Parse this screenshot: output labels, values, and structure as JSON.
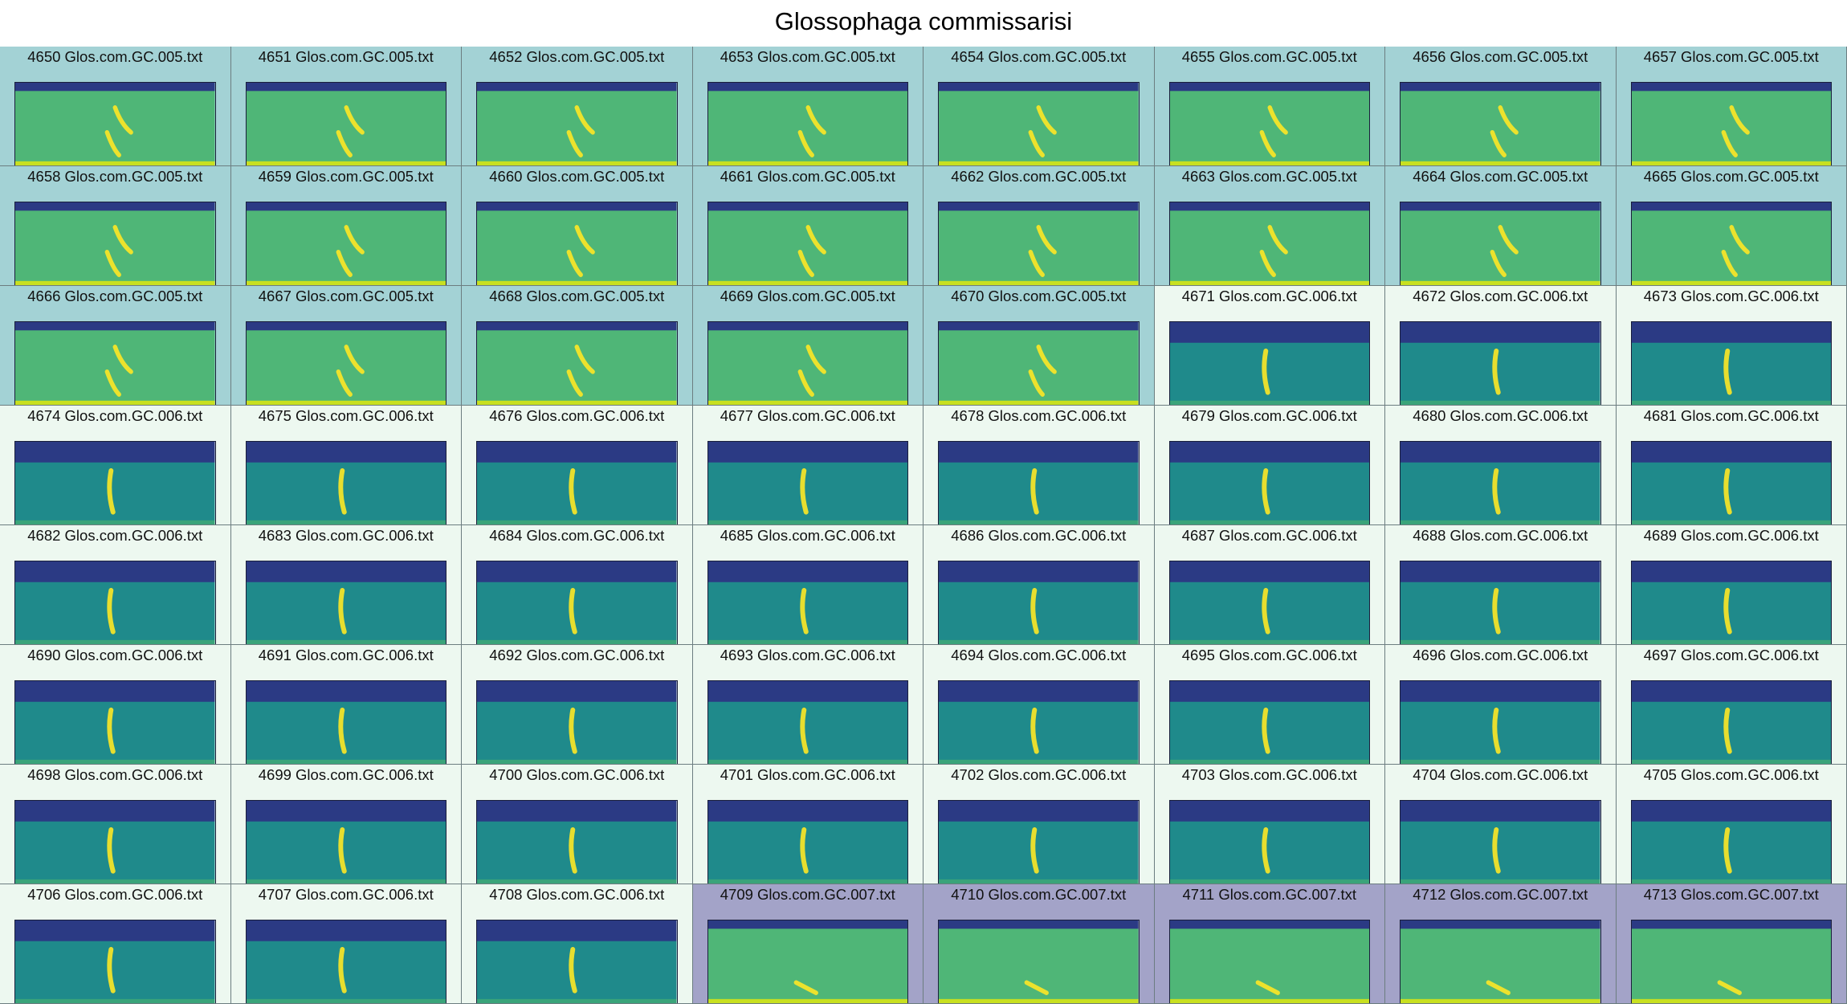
{
  "title": "Glossophaga commissarisi",
  "group_colors": {
    "GC.005": "#a3d2d5",
    "GC.006": "#edf8f0",
    "GC.007": "#a3a3c8"
  },
  "spectrogram_palette": {
    "band": "#2b3a84",
    "background": "#21918c",
    "call": "#fde725"
  },
  "cells": [
    {
      "label": "4650 Glos.com.GC.005.txt",
      "group": "GC.005"
    },
    {
      "label": "4651 Glos.com.GC.005.txt",
      "group": "GC.005"
    },
    {
      "label": "4652 Glos.com.GC.005.txt",
      "group": "GC.005"
    },
    {
      "label": "4653 Glos.com.GC.005.txt",
      "group": "GC.005"
    },
    {
      "label": "4654 Glos.com.GC.005.txt",
      "group": "GC.005"
    },
    {
      "label": "4655 Glos.com.GC.005.txt",
      "group": "GC.005"
    },
    {
      "label": "4656 Glos.com.GC.005.txt",
      "group": "GC.005"
    },
    {
      "label": "4657 Glos.com.GC.005.txt",
      "group": "GC.005"
    },
    {
      "label": "4658 Glos.com.GC.005.txt",
      "group": "GC.005"
    },
    {
      "label": "4659 Glos.com.GC.005.txt",
      "group": "GC.005"
    },
    {
      "label": "4660 Glos.com.GC.005.txt",
      "group": "GC.005"
    },
    {
      "label": "4661 Glos.com.GC.005.txt",
      "group": "GC.005"
    },
    {
      "label": "4662 Glos.com.GC.005.txt",
      "group": "GC.005"
    },
    {
      "label": "4663 Glos.com.GC.005.txt",
      "group": "GC.005"
    },
    {
      "label": "4664 Glos.com.GC.005.txt",
      "group": "GC.005"
    },
    {
      "label": "4665 Glos.com.GC.005.txt",
      "group": "GC.005"
    },
    {
      "label": "4666 Glos.com.GC.005.txt",
      "group": "GC.005"
    },
    {
      "label": "4667 Glos.com.GC.005.txt",
      "group": "GC.005"
    },
    {
      "label": "4668 Glos.com.GC.005.txt",
      "group": "GC.005"
    },
    {
      "label": "4669 Glos.com.GC.005.txt",
      "group": "GC.005"
    },
    {
      "label": "4670 Glos.com.GC.005.txt",
      "group": "GC.005"
    },
    {
      "label": "4671 Glos.com.GC.006.txt",
      "group": "GC.006"
    },
    {
      "label": "4672 Glos.com.GC.006.txt",
      "group": "GC.006"
    },
    {
      "label": "4673 Glos.com.GC.006.txt",
      "group": "GC.006"
    },
    {
      "label": "4674 Glos.com.GC.006.txt",
      "group": "GC.006"
    },
    {
      "label": "4675 Glos.com.GC.006.txt",
      "group": "GC.006"
    },
    {
      "label": "4676 Glos.com.GC.006.txt",
      "group": "GC.006"
    },
    {
      "label": "4677 Glos.com.GC.006.txt",
      "group": "GC.006"
    },
    {
      "label": "4678 Glos.com.GC.006.txt",
      "group": "GC.006"
    },
    {
      "label": "4679 Glos.com.GC.006.txt",
      "group": "GC.006"
    },
    {
      "label": "4680 Glos.com.GC.006.txt",
      "group": "GC.006"
    },
    {
      "label": "4681 Glos.com.GC.006.txt",
      "group": "GC.006"
    },
    {
      "label": "4682 Glos.com.GC.006.txt",
      "group": "GC.006"
    },
    {
      "label": "4683 Glos.com.GC.006.txt",
      "group": "GC.006"
    },
    {
      "label": "4684 Glos.com.GC.006.txt",
      "group": "GC.006"
    },
    {
      "label": "4685 Glos.com.GC.006.txt",
      "group": "GC.006"
    },
    {
      "label": "4686 Glos.com.GC.006.txt",
      "group": "GC.006"
    },
    {
      "label": "4687 Glos.com.GC.006.txt",
      "group": "GC.006"
    },
    {
      "label": "4688 Glos.com.GC.006.txt",
      "group": "GC.006"
    },
    {
      "label": "4689 Glos.com.GC.006.txt",
      "group": "GC.006"
    },
    {
      "label": "4690 Glos.com.GC.006.txt",
      "group": "GC.006"
    },
    {
      "label": "4691 Glos.com.GC.006.txt",
      "group": "GC.006"
    },
    {
      "label": "4692 Glos.com.GC.006.txt",
      "group": "GC.006"
    },
    {
      "label": "4693 Glos.com.GC.006.txt",
      "group": "GC.006"
    },
    {
      "label": "4694 Glos.com.GC.006.txt",
      "group": "GC.006"
    },
    {
      "label": "4695 Glos.com.GC.006.txt",
      "group": "GC.006"
    },
    {
      "label": "4696 Glos.com.GC.006.txt",
      "group": "GC.006"
    },
    {
      "label": "4697 Glos.com.GC.006.txt",
      "group": "GC.006"
    },
    {
      "label": "4698 Glos.com.GC.006.txt",
      "group": "GC.006"
    },
    {
      "label": "4699 Glos.com.GC.006.txt",
      "group": "GC.006"
    },
    {
      "label": "4700 Glos.com.GC.006.txt",
      "group": "GC.006"
    },
    {
      "label": "4701 Glos.com.GC.006.txt",
      "group": "GC.006"
    },
    {
      "label": "4702 Glos.com.GC.006.txt",
      "group": "GC.006"
    },
    {
      "label": "4703 Glos.com.GC.006.txt",
      "group": "GC.006"
    },
    {
      "label": "4704 Glos.com.GC.006.txt",
      "group": "GC.006"
    },
    {
      "label": "4705 Glos.com.GC.006.txt",
      "group": "GC.006"
    },
    {
      "label": "4706 Glos.com.GC.006.txt",
      "group": "GC.006"
    },
    {
      "label": "4707 Glos.com.GC.006.txt",
      "group": "GC.006"
    },
    {
      "label": "4708 Glos.com.GC.006.txt",
      "group": "GC.006"
    },
    {
      "label": "4709 Glos.com.GC.007.txt",
      "group": "GC.007"
    },
    {
      "label": "4710 Glos.com.GC.007.txt",
      "group": "GC.007"
    },
    {
      "label": "4711 Glos.com.GC.007.txt",
      "group": "GC.007"
    },
    {
      "label": "4712 Glos.com.GC.007.txt",
      "group": "GC.007"
    },
    {
      "label": "4713 Glos.com.GC.007.txt",
      "group": "GC.007"
    }
  ]
}
